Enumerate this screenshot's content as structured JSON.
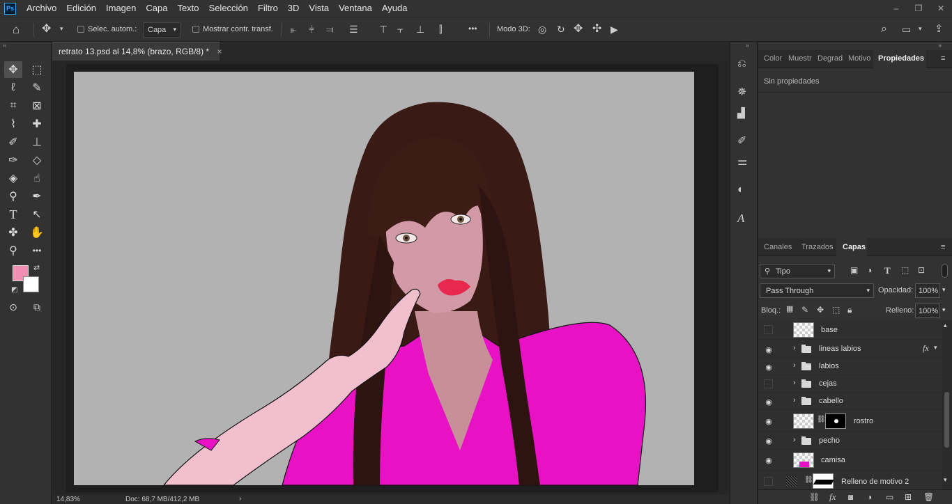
{
  "app": {
    "logo": "Ps"
  },
  "menu": [
    "Archivo",
    "Edición",
    "Imagen",
    "Capa",
    "Texto",
    "Selección",
    "Filtro",
    "3D",
    "Vista",
    "Ventana",
    "Ayuda"
  ],
  "window_controls": {
    "minimize": "–",
    "restore": "❐",
    "close": "✕"
  },
  "options": {
    "auto_select_label": "Selec. autom.:",
    "auto_select_target": "Capa",
    "transform_label": "Mostrar contr. transf.",
    "mode3d_label": "Modo 3D:",
    "more": "•••"
  },
  "document": {
    "tab_title": "retrato 13.psd al 14,8% (brazo, RGB/8) *",
    "tab_close": "×",
    "zoom": "14,83%",
    "doc_info": "Doc: 68,7 MB/412,2 MB",
    "canvas_bg": "#b2b2b2"
  },
  "colors": {
    "foreground": "#ef8fb1",
    "background": "#ffffff",
    "shirt": "#e812c4",
    "skin": "#d19aa6",
    "hair": "#3a1a14",
    "lips": "#e8284f"
  },
  "properties_panel": {
    "tabs": [
      "Color",
      "Muestr",
      "Degrad",
      "Motivo",
      "Propiedades"
    ],
    "active_tab": "Propiedades",
    "content": "Sin propiedades"
  },
  "layers_panel": {
    "tabs": [
      "Canales",
      "Trazados",
      "Capas"
    ],
    "active_tab": "Capas",
    "filter_label": "Tipo",
    "blend_mode": "Pass Through",
    "opacity_label": "Opacidad:",
    "opacity_value": "100%",
    "lock_label": "Bloq.:",
    "fill_label": "Relleno:",
    "fill_value": "100%",
    "layers": [
      {
        "name": "base",
        "visible": false,
        "kind": "pixel"
      },
      {
        "name": "lineas labios",
        "visible": true,
        "kind": "group",
        "fx": "fx"
      },
      {
        "name": "labios",
        "visible": true,
        "kind": "group"
      },
      {
        "name": "cejas",
        "visible": false,
        "kind": "group"
      },
      {
        "name": "cabello",
        "visible": true,
        "kind": "group"
      },
      {
        "name": "rostro",
        "visible": true,
        "kind": "masked"
      },
      {
        "name": "pecho",
        "visible": true,
        "kind": "group"
      },
      {
        "name": "camisa",
        "visible": true,
        "kind": "pixel"
      },
      {
        "name": "Relleno de motivo 2",
        "visible": false,
        "kind": "fill"
      }
    ]
  }
}
